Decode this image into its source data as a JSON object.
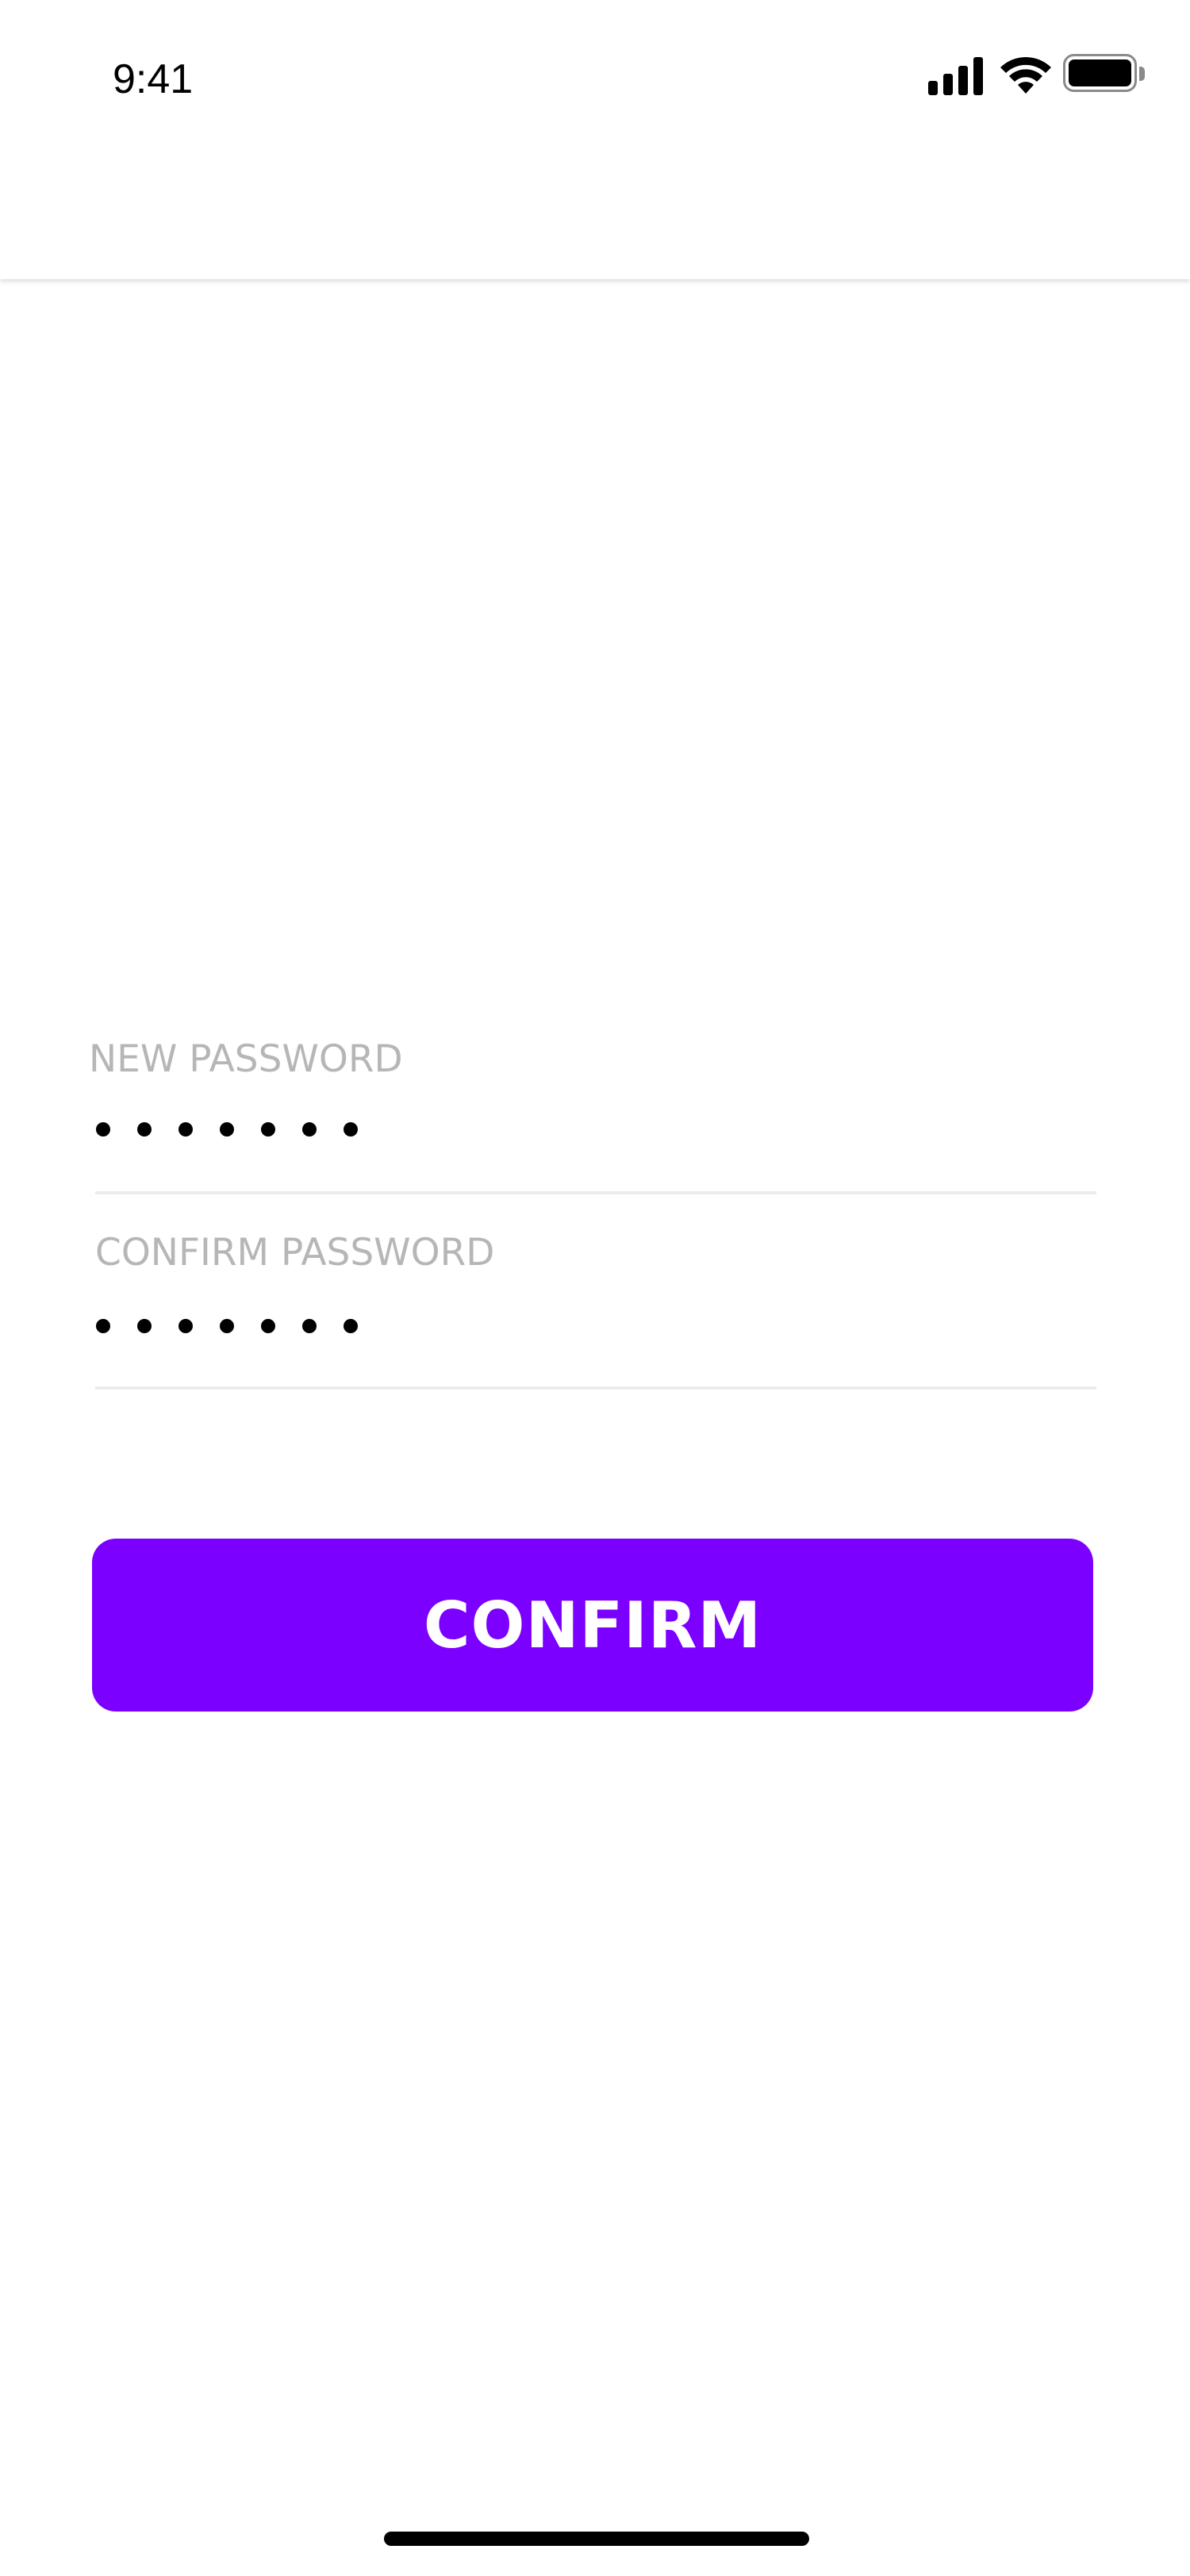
{
  "status_bar": {
    "time": "9:41",
    "icons": [
      "cellular-signal-icon",
      "wifi-icon",
      "battery-icon"
    ]
  },
  "form": {
    "new_password": {
      "label": "NEW PASSWORD",
      "value": "•••••••"
    },
    "confirm_password": {
      "label": "CONFIRM PASSWORD",
      "value": "•••••••"
    }
  },
  "confirm_button": {
    "label": "CONFIRM"
  },
  "colors": {
    "accent": "#7B00FF",
    "label": "#B6B6B6",
    "divider": "#ECECEC",
    "text": "#000000",
    "background": "#FFFFFF"
  }
}
